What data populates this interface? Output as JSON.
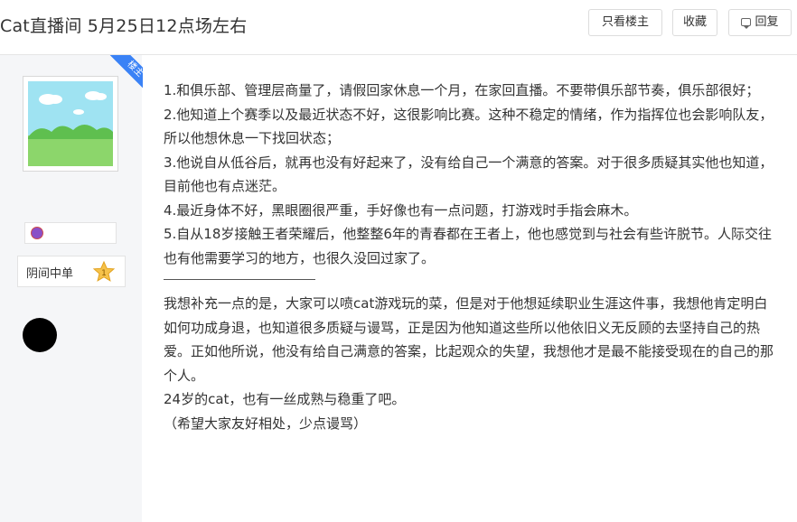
{
  "post": {
    "title": "Cat直播间 5月25日12点场左右",
    "actions": {
      "only_owner": "只看楼主",
      "favorite": "收藏",
      "reply": "回复"
    }
  },
  "user": {
    "owner_badge": "楼主",
    "tag": "阴间中单",
    "tag_badge_number": "1"
  },
  "content": {
    "paragraphs": [
      "1.和俱乐部、管理层商量了，请假回家休息一个月，在家回直播。不要带俱乐部节奏，俱乐部很好；",
      "2.他知道上个赛季以及最近状态不好，这很影响比赛。这种不稳定的情绪，作为指挥位也会影响队友，所以他想休息一下找回状态；",
      "3.他说自从低谷后，就再也没有好起来了，没有给自己一个满意的答案。对于很多质疑其实他也知道，目前他也有点迷茫。",
      "4.最近身体不好，黑眼圈很严重，手好像也有一点问题，打游戏时手指会麻木。",
      "5.自从18岁接触王者荣耀后，他整整6年的青春都在王者上，他也感觉到与社会有些许脱节。人际交往也有他需要学习的地方，也很久没回过家了。"
    ],
    "supplement": "我想补充一点的是，大家可以喷cat游戏玩的菜，但是对于他想延续职业生涯这件事，我想他肯定明白如何功成身退，也知道很多质疑与谩骂，正是因为他知道这些所以他依旧义无反顾的去坚持自己的热爱。正如他所说，他没有给自己满意的答案，比起观众的失望，我想他才是最不能接受现在的自己的那个人。",
    "age_line": "24岁的cat，也有一丝成熟与稳重了吧。",
    "closing": "（希望大家友好相处，少点谩骂）"
  },
  "colors": {
    "owner_badge_bg": "#3a82f6",
    "sidebar_bg": "#f5f6f8",
    "text": "#333333"
  }
}
